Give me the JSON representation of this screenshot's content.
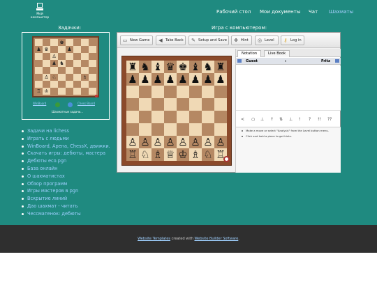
{
  "logo": {
    "line1": "Мой",
    "line2": "компьютер"
  },
  "nav": [
    {
      "label": "Рабочий стол"
    },
    {
      "label": "Мои документы"
    },
    {
      "label": "Чат"
    },
    {
      "label": "Шахматы"
    }
  ],
  "left_title": "Задачки:",
  "right_title": "Игра с компьютером:",
  "mini": {
    "pieces": [
      [
        "",
        "",
        "",
        "♚",
        "",
        "",
        "",
        ""
      ],
      [
        "♟",
        "♛",
        "",
        "",
        "♟",
        "",
        "",
        ""
      ],
      [
        "",
        "",
        "♙",
        "",
        "",
        "",
        "",
        ""
      ],
      [
        "",
        "",
        "♟",
        "♞",
        "",
        "",
        "",
        ""
      ],
      [
        "",
        "",
        "",
        "",
        "",
        "",
        "",
        ""
      ],
      [
        "",
        "♙",
        "♘",
        "",
        "",
        "",
        "♗",
        ""
      ],
      [
        "",
        "",
        "",
        "",
        "",
        "",
        "",
        ""
      ],
      [
        "♖",
        "♔",
        "",
        "",
        "",
        "",
        "",
        ""
      ]
    ],
    "left_link": "WinBoard",
    "right_link": "Chess Board",
    "caption": "Шахматные задачи..."
  },
  "menu": [
    "Задачи на lichess",
    "Играть с людьми",
    "WinBoard, Арена, ChessX, движки.",
    "Скачать игры: дебюты, мастера",
    "Дебюты eco.pgn",
    "База онлайн",
    "О шахматистах",
    "Обзор программ",
    "Игры мастеров в pgn",
    "Вскрытие линий",
    "Дао шахмат - читать",
    "Чессматенок: дебюты"
  ],
  "toolbar": {
    "new_game": "New Game",
    "take_back": "Take Back",
    "setup_save": "Setup and Save",
    "hint": "Hint",
    "level": "Level",
    "login": "Log in"
  },
  "board": [
    [
      "♜",
      "♞",
      "♝",
      "♛",
      "♚",
      "♝",
      "♞",
      "♜"
    ],
    [
      "♟",
      "♟",
      "♟",
      "♟",
      "♟",
      "♟",
      "♟",
      "♟"
    ],
    [
      "",
      "",
      "",
      "",
      "",
      "",
      "",
      ""
    ],
    [
      "",
      "",
      "",
      "",
      "",
      "",
      "",
      ""
    ],
    [
      "",
      "",
      "",
      "",
      "",
      "",
      "",
      ""
    ],
    [
      "",
      "",
      "",
      "",
      "",
      "",
      "",
      ""
    ],
    [
      "♙",
      "♙",
      "♙",
      "♙",
      "♙",
      "♙",
      "♙",
      "♙"
    ],
    [
      "♖",
      "♘",
      "♗",
      "♕",
      "♔",
      "♗",
      "♘",
      "♖"
    ]
  ],
  "panel": {
    "tab_notation": "Notation",
    "tab_livebook": "Live Book",
    "player_white": "Guest",
    "player_black": "Fritz"
  },
  "controls": [
    "<",
    "○",
    "⊥",
    "↑",
    "⇅",
    "⊥",
    "!",
    "?",
    "!!",
    "??"
  ],
  "hints": [
    "Make a move or select \"Analysis\" from the Level button menu.",
    "Click and hold a piece to get hints."
  ],
  "footer": {
    "link1": "Website Templates",
    "mid": "created with",
    "link2": "Website Builder Software",
    "end": "."
  }
}
